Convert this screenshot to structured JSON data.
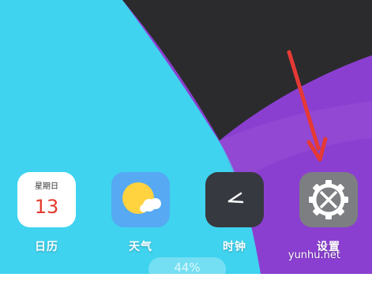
{
  "apps": [
    {
      "label": "日历",
      "icon": "calendar-icon",
      "weekday": "星期日",
      "day": "13"
    },
    {
      "label": "天气",
      "icon": "weather-icon"
    },
    {
      "label": "时钟",
      "icon": "clock-icon"
    },
    {
      "label": "设置",
      "icon": "settings-icon"
    }
  ],
  "status": {
    "battery": "44%"
  },
  "watermark": "yunhu.net",
  "colors": {
    "wallpaper_cyan": "#3fd3ef",
    "wallpaper_dark": "#2b2b2d",
    "wallpaper_purple": "#8b3fd1",
    "arrow_red": "#e53935",
    "calendar_day_red": "#e23b2c"
  }
}
